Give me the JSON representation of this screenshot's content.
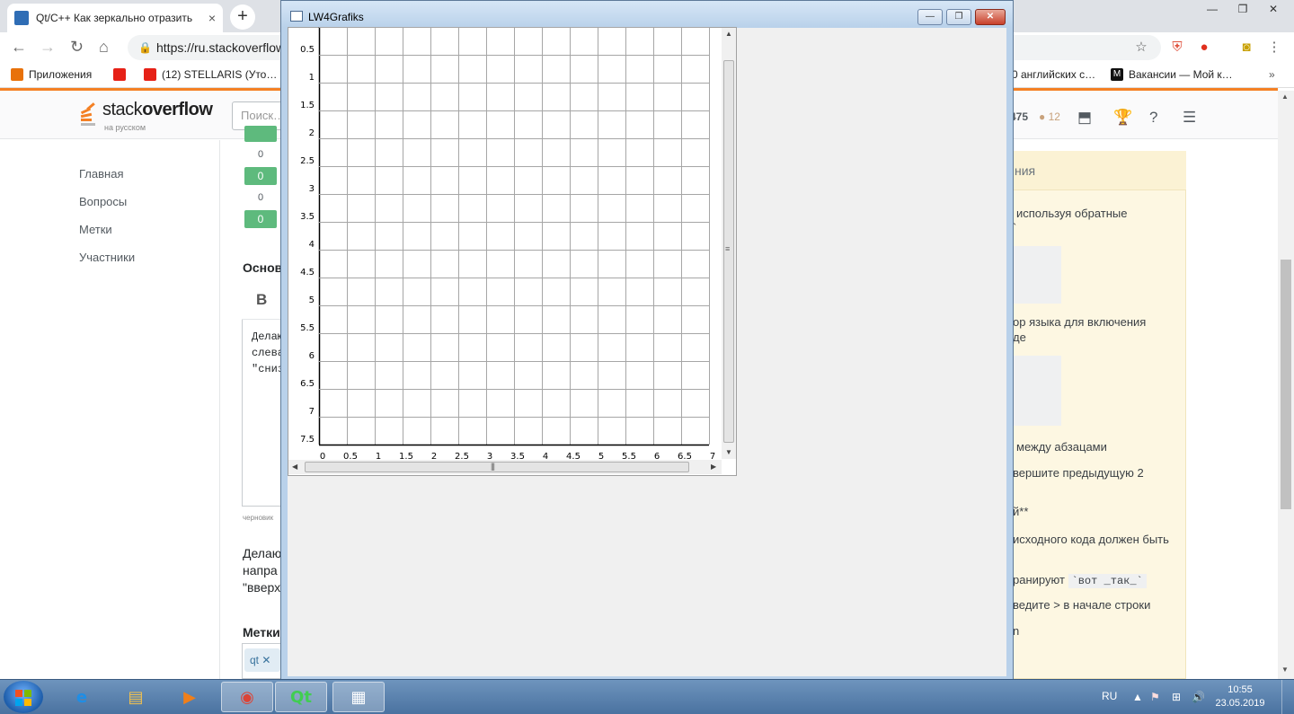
{
  "browser": {
    "tab_title": "Qt/C++ Как зеркально отразить",
    "tab_close": "×",
    "new_tab": "+",
    "url": "https://ru.stackoverflow",
    "window_controls": [
      "—",
      "❐",
      "✕"
    ],
    "bookmarks": [
      {
        "label": "Приложения",
        "icon": "apps-grid-icon"
      },
      {
        "label": "",
        "icon": "youtube-icon"
      },
      {
        "label": "(12) STELLARIS (Уто…",
        "icon": "youtube-icon"
      },
      {
        "label": "0 английских с…",
        "icon": "site-icon"
      },
      {
        "label": "Вакансии — Мой к…",
        "icon": "moikrug-icon"
      }
    ],
    "bookmarks_more": "»"
  },
  "so": {
    "logo_word1": "stack",
    "logo_word2": "overflow",
    "logo_sub": "на русском",
    "search_placeholder": "Поиск…",
    "rep": "475",
    "badge": "● 12",
    "nav": [
      "Главная",
      "Вопросы",
      "Метки",
      "Участники"
    ],
    "votes": [
      {
        "type": "zero",
        "text": "0"
      },
      {
        "type": "green",
        "text": "0"
      },
      {
        "type": "zero",
        "text": "0"
      },
      {
        "type": "green",
        "text": "0"
      }
    ],
    "section_title": "Основ",
    "bold_button": "B",
    "editor_lines": [
      "Делаю",
      "слева",
      "\"сниз"
    ],
    "draft_note": "черновик",
    "preview_lines": [
      "Делаю",
      "напра",
      "\"вверх"
    ],
    "tags_label": "Метки",
    "tag": "qt ✕",
    "help_head": "ния",
    "help_lines": [
      "используя обратные",
      "`",
      "ор языка для включения",
      "де",
      "между абзацами",
      "вершите предыдущую 2",
      "й**",
      "исходного кода должен быть",
      "ранируют",
      "ведите > в начале строки",
      "n"
    ],
    "help_code": "`вот _так_`"
  },
  "qt_window": {
    "title": "LW4Grafiks",
    "controls": [
      "—",
      "❐",
      "✕"
    ],
    "y_labels": [
      "0.5",
      "1",
      "1.5",
      "2",
      "2.5",
      "3",
      "3.5",
      "4",
      "4.5",
      "5",
      "5.5",
      "6",
      "6.5",
      "7",
      "7.5"
    ],
    "x_labels": [
      "0",
      "0.5",
      "1",
      "1.5",
      "2",
      "2.5",
      "3",
      "3.5",
      "4",
      "4.5",
      "5",
      "5.5",
      "6",
      "6.5",
      "7"
    ],
    "grid_rows": 15,
    "grid_cols": 14,
    "grip": "≡",
    "hgrip": "|||"
  },
  "taskbar": {
    "apps": [
      {
        "name": "ie-icon",
        "glyph": "e",
        "color": "#1e8ee6"
      },
      {
        "name": "explorer-icon",
        "glyph": "▤",
        "color": "#f2c14e"
      },
      {
        "name": "media-player-icon",
        "glyph": "▶",
        "color": "#f07f1a"
      },
      {
        "name": "chrome-icon",
        "glyph": "◉",
        "color": "#db4437"
      },
      {
        "name": "qt-creator-icon",
        "glyph": "Qt",
        "color": "#41cd52"
      },
      {
        "name": "lw4grafiks-icon",
        "glyph": "▦",
        "color": "#ffffff"
      }
    ],
    "lang": "RU",
    "clock_time": "10:55",
    "clock_date": "23.05.2019"
  }
}
